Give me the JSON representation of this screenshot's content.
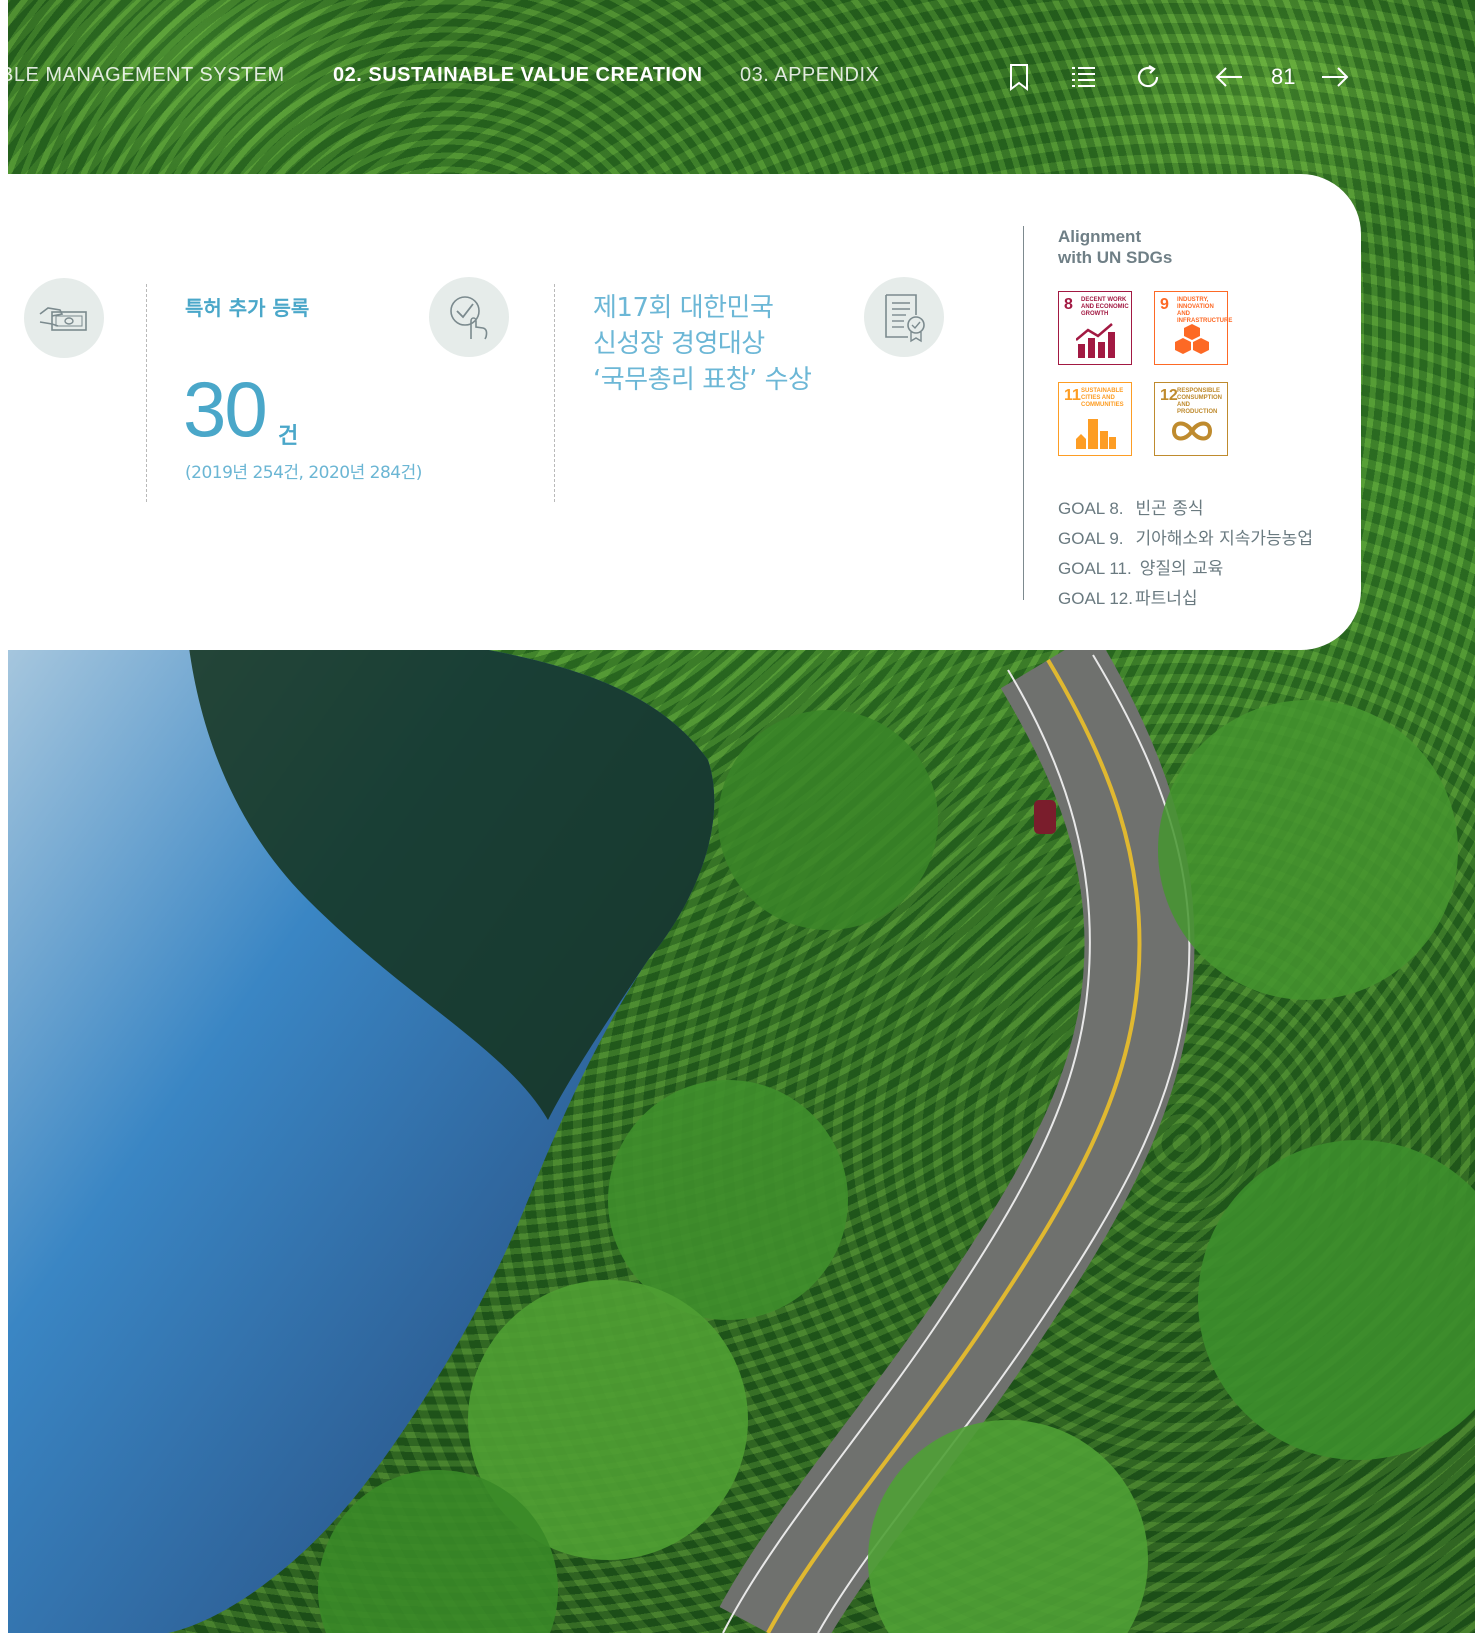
{
  "nav": {
    "items": [
      "BLE MANAGEMENT SYSTEM",
      "02. SUSTAINABLE VALUE CREATION",
      "03. APPENDIX"
    ],
    "page_number": "81",
    "icons": [
      "bookmark-icon",
      "list-icon",
      "refresh-icon",
      "arrow-left-icon",
      "arrow-right-icon"
    ]
  },
  "patent": {
    "title": "특허 추가 등록",
    "value": "30",
    "unit": "건",
    "note": "(2019년 254건, 2020년 284건)"
  },
  "award": {
    "lines": [
      "제17회 대한민국",
      "신성장 경영대상",
      "‘국무총리 표창’ 수상"
    ]
  },
  "sdg": {
    "heading": [
      "Alignment",
      "with UN SDGs"
    ],
    "tiles": [
      {
        "number": "8",
        "caption": "DECENT WORK AND ECONOMIC GROWTH",
        "color": "#a21942"
      },
      {
        "number": "9",
        "caption": "INDUSTRY, INNOVATION AND INFRASTRUCTURE",
        "color": "#fd6925"
      },
      {
        "number": "11",
        "caption": "SUSTAINABLE CITIES AND COMMUNITIES",
        "color": "#fd9d24"
      },
      {
        "number": "12",
        "caption": "RESPONSIBLE CONSUMPTION AND PRODUCTION",
        "color": "#bf8b2e"
      }
    ],
    "goals": [
      {
        "label": "GOAL 8.",
        "text": "빈곤 종식"
      },
      {
        "label": "GOAL 9.",
        "text": "기아해소와 지속가능농업"
      },
      {
        "label": "GOAL 11.",
        "text": "양질의 교육"
      },
      {
        "label": "GOAL 12.",
        "text": "파트너십"
      }
    ]
  },
  "colors": {
    "accent": "#4aa7c9",
    "light_accent": "#6cb7d6",
    "gray_text": "#6a7a80"
  }
}
